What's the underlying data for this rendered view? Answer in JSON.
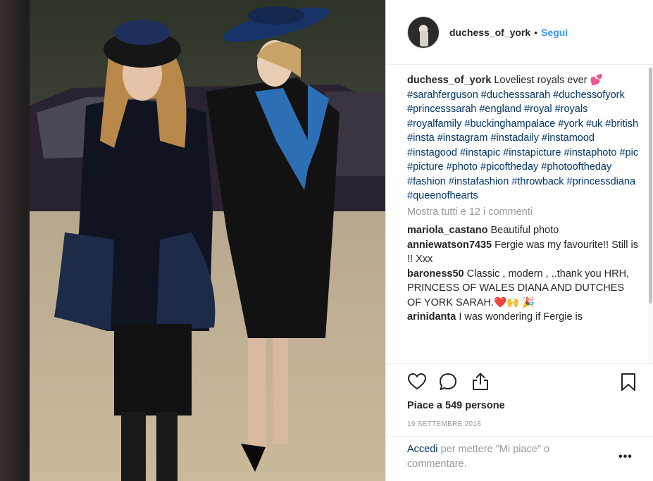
{
  "post": {
    "username": "duchess_of_york",
    "separator": "•",
    "follow_label": "Segui",
    "caption_text": "Loveliest royals ever 💕",
    "hashtags": "#sarahferguson #duchesssarah #duchessofyork #princesssarah #england #royal #royals #royalfamily #buckinghampalace #york #uk #british #insta #instagram #instadaily #instamood #instagood #instapic #instapicture #instaphoto #pic #picture #photo #picoftheday #photooftheday #fashion #instafashion #throwback #princessdiana #queenofhearts",
    "view_all": "Mostra tutti e 12 i commenti"
  },
  "comments": [
    {
      "user": "mariola_castano",
      "text": "Beautiful photo"
    },
    {
      "user": "anniewatson7435",
      "text": "Fergie was my favourite!! Still is !! Xxx"
    },
    {
      "user": "baroness50",
      "text": "Classic , modern , ..thank you HRH, PRINCESS OF WALES DIANA AND DUTCHES OF YORK SARAH.❤️🙌 🎉"
    },
    {
      "user": "arinidanta",
      "text": "I was wondering if Fergie is"
    }
  ],
  "actions": {
    "like_icon": "heart-icon",
    "comment_icon": "comment-icon",
    "share_icon": "share-icon",
    "save_icon": "bookmark-icon"
  },
  "likes_text": "Piace a 549 persone",
  "date_text": "19 SETTEMBRE 2018",
  "login_prompt": {
    "link": "Accedi",
    "rest": "per mettere \"Mi piace\" o commentare."
  },
  "more_options": "•••",
  "colors": {
    "link_blue": "#003569",
    "follow_blue": "#3897f0",
    "muted_gray": "#999999",
    "text": "#262626"
  }
}
